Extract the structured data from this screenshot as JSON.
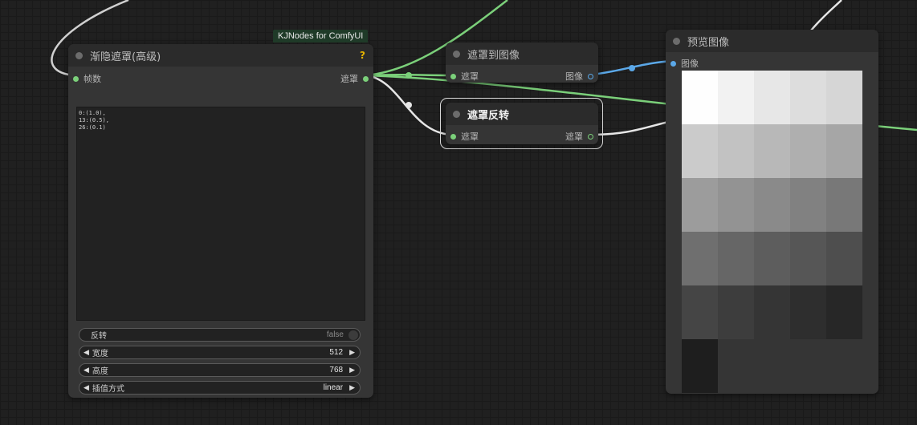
{
  "nodes": {
    "fade_mask": {
      "badge": "KJNodes for ComfyUI",
      "title": "渐隐遮罩(高级)",
      "help": "?",
      "input_label": "帧数",
      "output_label": "遮罩",
      "points_text": "0:(1.0),\n13:(0.5),\n26:(0.1)",
      "widgets": {
        "invert": {
          "label": "反转",
          "value": "false"
        },
        "width": {
          "label": "宽度",
          "value": "512"
        },
        "height": {
          "label": "高度",
          "value": "768"
        },
        "interpolation": {
          "label": "插值方式",
          "value": "linear"
        }
      }
    },
    "mask_to_image": {
      "title": "遮罩到图像",
      "input_label": "遮罩",
      "output_label": "图像"
    },
    "invert_mask": {
      "title": "遮罩反转",
      "input_label": "遮罩",
      "output_label": "遮罩"
    },
    "preview_image": {
      "title": "预览图像",
      "input_label": "图像",
      "grid_colors": [
        [
          "#fefefe",
          "#f2f2f2",
          "#e7e7e7",
          "#dddddd",
          "#d6d6d6"
        ],
        [
          "#cbcbcb",
          "#c2c2c2",
          "#b8b8b8",
          "#afafaf",
          "#a6a6a6"
        ],
        [
          "#9c9c9c",
          "#939393",
          "#8a8a8a",
          "#818181",
          "#787878"
        ],
        [
          "#6f6f6f",
          "#666666",
          "#5d5d5d",
          "#565656",
          "#4e4e4e"
        ],
        [
          "#454545",
          "#3d3d3d",
          "#353535",
          "#2e2e2e",
          "#272727"
        ],
        [
          "#1e1e1e"
        ]
      ]
    }
  },
  "colors": {
    "mask_link": "#7bd07a",
    "image_link": "#5ba8e8",
    "selected_link": "#e6e6e6",
    "help": "#e6b400"
  }
}
